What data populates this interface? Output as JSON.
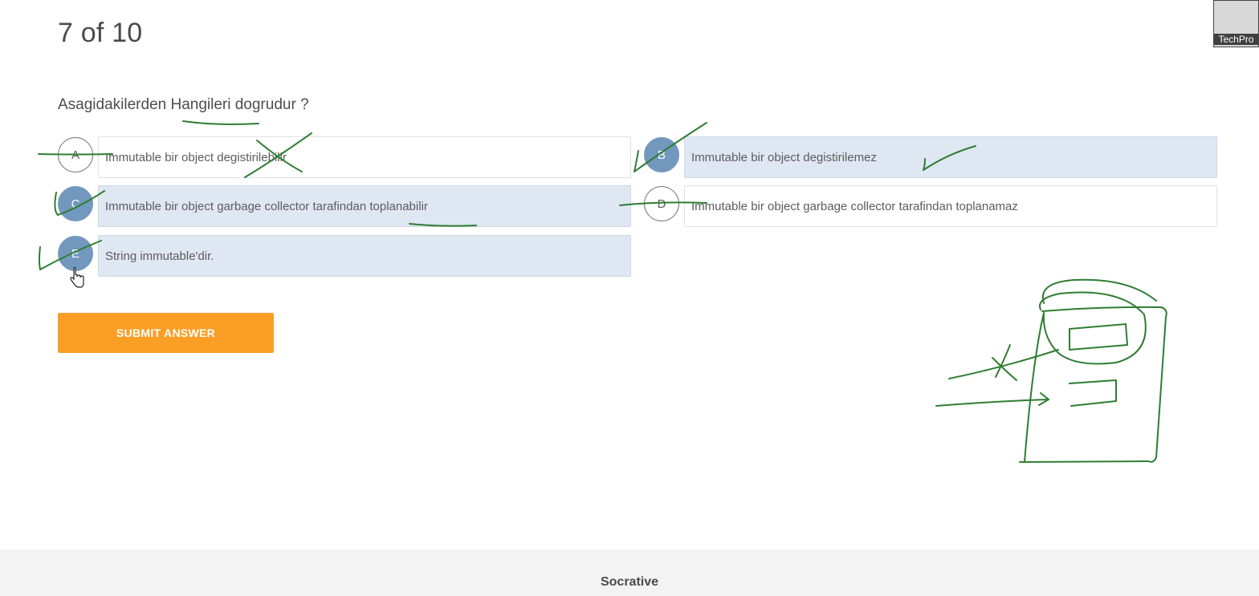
{
  "progress": "7 of 10",
  "question": "Asagidakilerden Hangileri dogrudur ?",
  "options": [
    {
      "letter": "A",
      "text": "Immutable bir object degistirilebilir",
      "selected": false
    },
    {
      "letter": "B",
      "text": "Immutable bir object degistirilemez",
      "selected": true
    },
    {
      "letter": "C",
      "text": "Immutable bir object garbage collector tarafindan toplanabilir",
      "selected": true
    },
    {
      "letter": "D",
      "text": "Immutable bir object garbage collector tarafindan toplanamaz",
      "selected": false
    },
    {
      "letter": "E",
      "text": "String immutable'dir.",
      "selected": true
    }
  ],
  "submit_label": "SUBMIT ANSWER",
  "footer_brand": "Socrative",
  "participant_thumbnail": "TechPro",
  "colors": {
    "selected_bubble": "#7298bd",
    "selected_box": "#dfe7f2",
    "submit": "#fb9e26",
    "annotation_ink": "#2e7d32"
  }
}
